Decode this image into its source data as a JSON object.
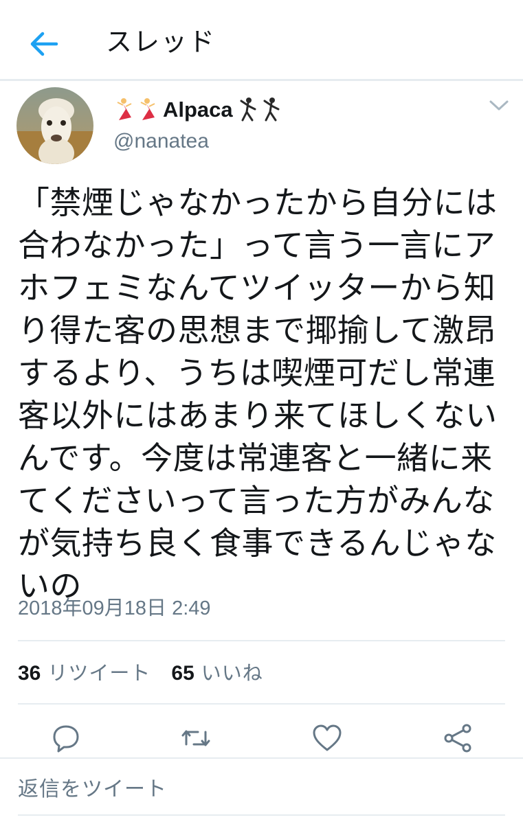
{
  "header": {
    "title": "スレッド",
    "back_icon": "arrow-left-icon",
    "accent_color": "#1da1f2"
  },
  "tweet": {
    "display_name": "Alpaca",
    "name_emoji_left": [
      "dancer-emoji",
      "dancer-emoji"
    ],
    "name_emoji_right": [
      "man-dancing-emoji",
      "man-dancing-emoji"
    ],
    "handle": "@nanatea",
    "text": "「禁煙じゃなかったから自分には合わなかった」って言う一言にアホフェミなんてツイッターから知り得た客の思想まで揶揄して激昂するより、うちは喫煙可だし常連客以外にはあまり来てほしくないんです。今度は常連客と一緒に来てくださいって言った方がみんなが気持ち良く食事できるんじゃないの",
    "timestamp": "2018年09月18日 2:49",
    "retweet_count": "36",
    "retweet_label": "リツイート",
    "like_count": "65",
    "like_label": "いいね"
  },
  "actions": [
    "reply-icon",
    "retweet-icon",
    "like-icon",
    "share-icon"
  ],
  "reply": {
    "placeholder": "返信をツイート"
  }
}
